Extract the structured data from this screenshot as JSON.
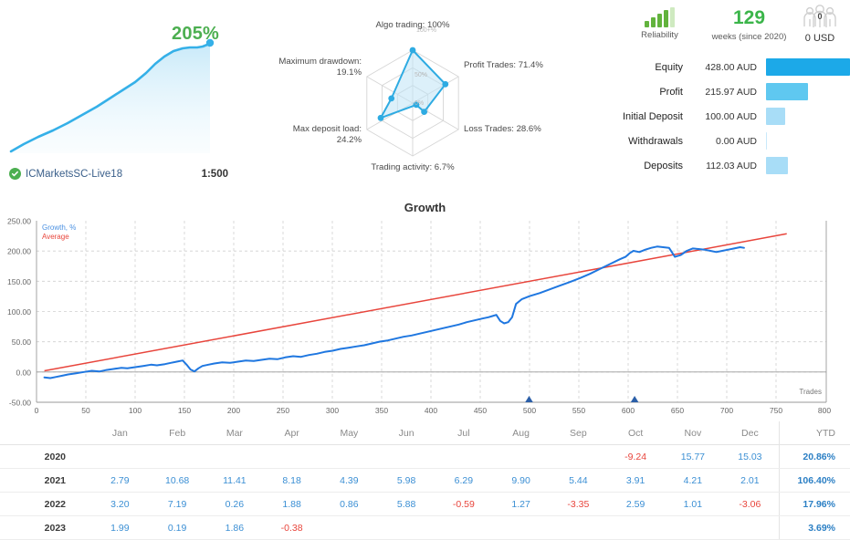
{
  "account": {
    "growth_percent": "205%",
    "broker": "ICMarketsSC-Live18",
    "leverage": "1:500",
    "verified_icon": "check-badge-icon"
  },
  "radar": {
    "axes": [
      {
        "key": "algo_trading",
        "label": "Algo trading: 100%",
        "value": 100.0
      },
      {
        "key": "profit_trades",
        "label": "Profit Trades: 71.4%",
        "value": 71.4
      },
      {
        "key": "loss_trades",
        "label": "Loss Trades: 28.6%",
        "value": 28.6
      },
      {
        "key": "trading_activity",
        "label": "Trading activity: 6.7%",
        "value": 6.7
      },
      {
        "key": "max_deposit_load",
        "label": "Max deposit load:\n24.2%",
        "value": 24.2
      },
      {
        "key": "maximum_drawdown",
        "label": "Maximum drawdown:\n19.1%",
        "value": 19.1
      }
    ],
    "ring_labels": [
      "100+%",
      "50%",
      "0%"
    ],
    "label_algo": "Algo trading: 100%",
    "label_profit": "Profit Trades: 71.4%",
    "label_loss": "Loss Trades: 28.6%",
    "label_activity": "Trading activity: 6.7%",
    "label_deposit_load_l1": "Max deposit load:",
    "label_deposit_load_l2": "24.2%",
    "label_drawdown_l1": "Maximum drawdown:",
    "label_drawdown_l2": "19.1%",
    "ring_100": "100+%",
    "ring_50": "50%",
    "ring_0": "0%"
  },
  "header_stats": {
    "reliability_label": "Reliability",
    "reliability_icon": "signal-bars-icon",
    "reliability_filled": 4,
    "reliability_total": 5,
    "weeks_value": "129",
    "weeks_label": "weeks (since 2020)",
    "subscribers_icon": "people-group-icon",
    "subscribers_count": "0",
    "subscribers_price": "0 USD"
  },
  "balance_rows": [
    {
      "label": "Equity",
      "value": "428.00 AUD",
      "pct": 100,
      "color": "#1ca9e8"
    },
    {
      "label": "Profit",
      "value": "215.97 AUD",
      "pct": 50,
      "color": "#5fc8f0"
    },
    {
      "label": "Initial Deposit",
      "value": "100.00 AUD",
      "pct": 23,
      "color": "#a8ddf7"
    },
    {
      "label": "Withdrawals",
      "value": "0.00 AUD",
      "pct": 1,
      "color": "#c9e9fb"
    },
    {
      "label": "Deposits",
      "value": "112.03 AUD",
      "pct": 26,
      "color": "#a8ddf7"
    }
  ],
  "chart_data": {
    "type": "line",
    "title": "Growth",
    "xlabel": "Trades",
    "ylabel": "",
    "xlim": [
      0,
      800
    ],
    "ylim": [
      -50,
      250
    ],
    "xticks": [
      0,
      50,
      100,
      150,
      200,
      250,
      300,
      350,
      400,
      450,
      500,
      550,
      600,
      650,
      700,
      750,
      800
    ],
    "yticks": [
      "-50.00",
      "0.00",
      "50.00",
      "100.00",
      "150.00",
      "200.00",
      "250.00"
    ],
    "grid": true,
    "legend": [
      "Growth, %",
      "Average"
    ],
    "legend_position": "top-left-inside",
    "series": [
      {
        "name": "Growth, %",
        "color": "#1f77e0",
        "x": [
          8,
          14,
          20,
          26,
          32,
          40,
          48,
          56,
          64,
          70,
          78,
          86,
          92,
          100,
          108,
          116,
          122,
          130,
          136,
          142,
          148,
          152,
          156,
          160,
          164,
          168,
          174,
          180,
          188,
          196,
          204,
          212,
          220,
          228,
          236,
          244,
          252,
          260,
          268,
          276,
          284,
          292,
          300,
          308,
          316,
          324,
          332,
          340,
          348,
          356,
          364,
          372,
          380,
          388,
          396,
          404,
          412,
          420,
          428,
          436,
          444,
          452,
          458,
          462,
          466,
          470,
          474,
          478,
          482,
          486,
          492,
          500,
          510,
          520,
          530,
          540,
          550,
          560,
          570,
          580,
          590,
          596,
          600,
          604,
          610,
          616,
          622,
          628,
          634,
          640,
          646,
          652,
          658,
          664,
          670,
          676,
          682,
          688,
          694,
          700,
          706,
          712,
          716
        ],
        "y": [
          -9,
          -10,
          -8,
          -6,
          -4,
          -2,
          0,
          2,
          1,
          3,
          5,
          7,
          6,
          8,
          10,
          12,
          11,
          13,
          15,
          17,
          19,
          12,
          4,
          1,
          6,
          10,
          12,
          14,
          16,
          15,
          17,
          19,
          18,
          20,
          22,
          21,
          24,
          26,
          25,
          28,
          30,
          33,
          35,
          38,
          40,
          42,
          44,
          47,
          50,
          52,
          55,
          58,
          60,
          63,
          66,
          69,
          72,
          75,
          78,
          82,
          85,
          88,
          90,
          92,
          94,
          84,
          80,
          82,
          90,
          112,
          120,
          125,
          130,
          136,
          142,
          148,
          155,
          162,
          170,
          178,
          186,
          190,
          196,
          200,
          198,
          202,
          205,
          207,
          206,
          205,
          190,
          193,
          200,
          204,
          203,
          202,
          200,
          198,
          200,
          202,
          204,
          206,
          205
        ]
      },
      {
        "name": "Average",
        "color": "#e8453c",
        "x": [
          8,
          760
        ],
        "y": [
          2,
          228
        ]
      }
    ],
    "markers": {
      "name": "trade-markers",
      "color": "#2b5fa8",
      "x": [
        495,
        602
      ],
      "y": [
        -50,
        -50
      ]
    }
  },
  "monthly_table": {
    "columns": [
      "",
      "Jan",
      "Feb",
      "Mar",
      "Apr",
      "May",
      "Jun",
      "Jul",
      "Aug",
      "Sep",
      "Oct",
      "Nov",
      "Dec",
      "YTD"
    ],
    "rows": [
      {
        "year": "2020",
        "months": [
          "",
          "",
          "",
          "",
          "",
          "",
          "",
          "",
          "",
          "-9.24",
          "15.77",
          "15.03"
        ],
        "ytd": "20.86%"
      },
      {
        "year": "2021",
        "months": [
          "2.79",
          "10.68",
          "11.41",
          "8.18",
          "4.39",
          "5.98",
          "6.29",
          "9.90",
          "5.44",
          "3.91",
          "4.21",
          "2.01"
        ],
        "ytd": "106.40%"
      },
      {
        "year": "2022",
        "months": [
          "3.20",
          "7.19",
          "0.26",
          "1.88",
          "0.86",
          "5.88",
          "-0.59",
          "1.27",
          "-3.35",
          "2.59",
          "1.01",
          "-3.06"
        ],
        "ytd": "17.96%"
      },
      {
        "year": "2023",
        "months": [
          "1.99",
          "0.19",
          "1.86",
          "-0.38",
          "",
          "",
          "",
          "",
          "",
          "",
          "",
          ""
        ],
        "ytd": "3.69%"
      }
    ]
  },
  "colors": {
    "accent_blue": "#1f77e0",
    "light_blue": "#5fc8f0",
    "red": "#e8453c",
    "green": "#4caf50",
    "grey_text": "#8a8a8a"
  }
}
